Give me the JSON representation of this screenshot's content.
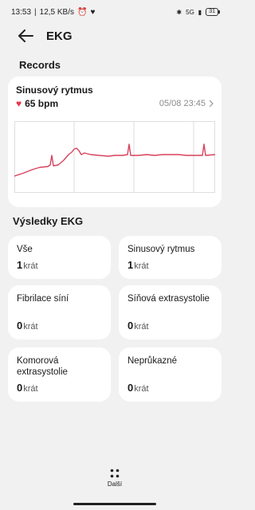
{
  "status_bar": {
    "time": "13:53",
    "speed": "12,5 KB/s",
    "signal": "5G",
    "battery": "31"
  },
  "header": {
    "title": "EKG"
  },
  "records": {
    "section_title": "Records",
    "card": {
      "title": "Sinusový rytmus",
      "bpm": "65 bpm",
      "date": "05/08 23:45",
      "line_color": "#d9415c"
    }
  },
  "results": {
    "section_title": "Výsledky EKG",
    "unit": "krát",
    "tiles": [
      {
        "label": "Vše",
        "count": "1"
      },
      {
        "label": "Sinusový rytmus",
        "count": "1"
      },
      {
        "label": "Fibrilace síní",
        "count": "0"
      },
      {
        "label": "Síňová extrasystolie",
        "count": "0"
      },
      {
        "label": "Komorová extrasystolie",
        "count": "0"
      },
      {
        "label": "Neprůkazné",
        "count": "0"
      }
    ]
  },
  "footer": {
    "more_label": "Další"
  },
  "colors": {
    "accent": "#e8344a",
    "background": "#f1f1f1",
    "card": "#ffffff"
  }
}
